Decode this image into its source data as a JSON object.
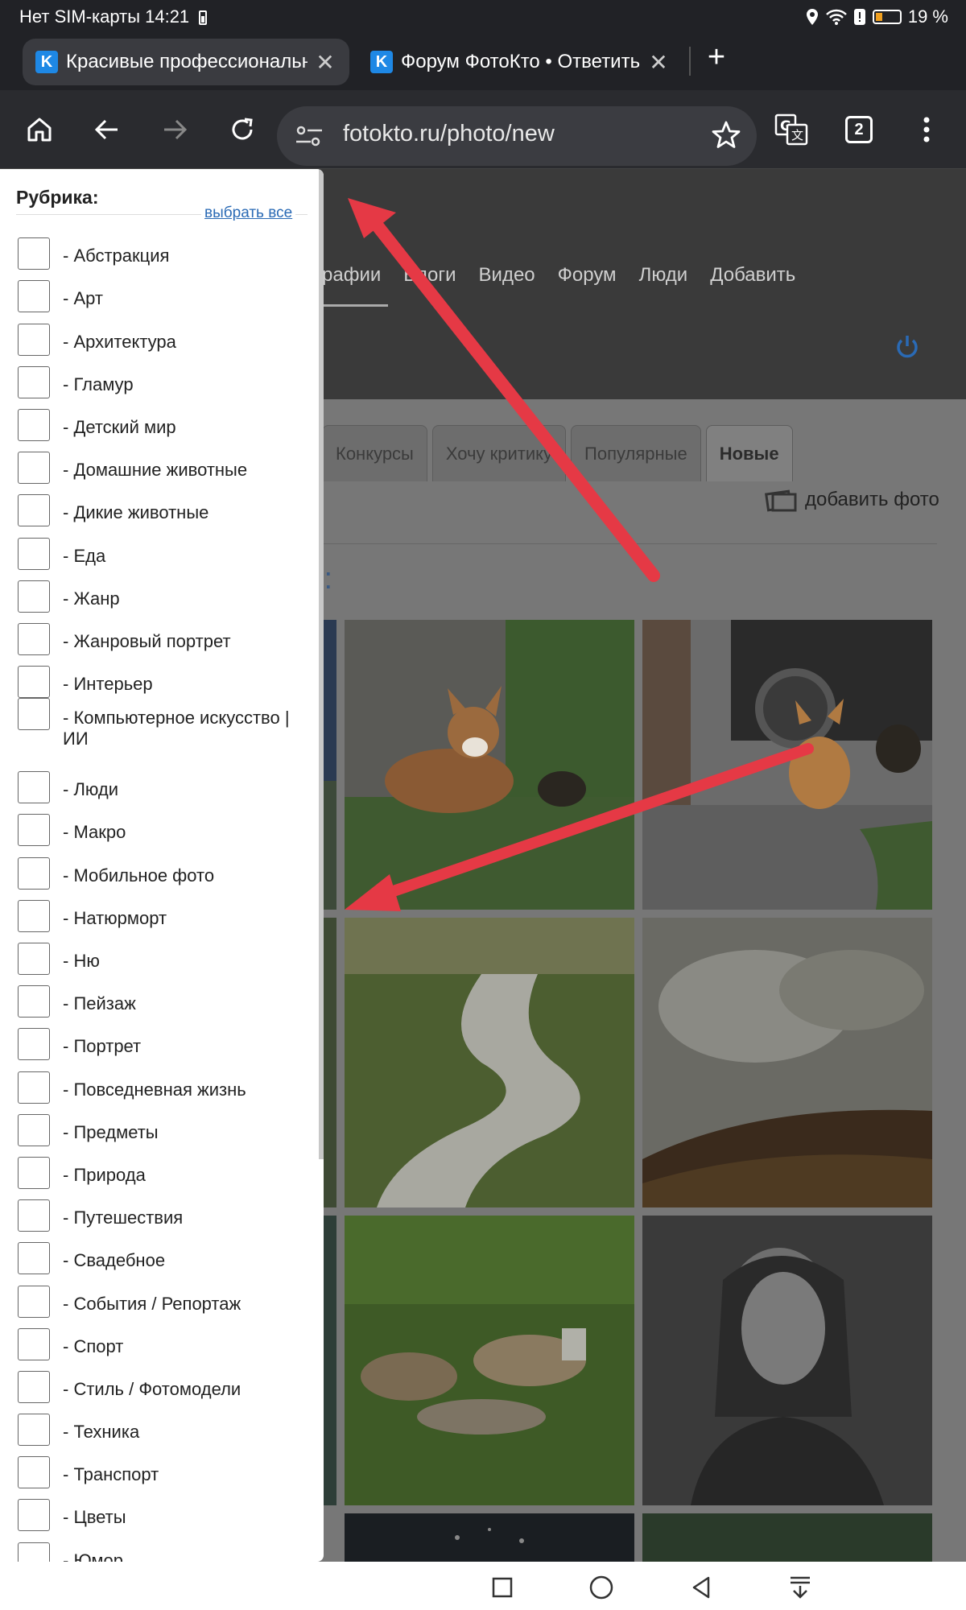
{
  "status": {
    "carrier_time": "Нет SIM-карты 14:21",
    "battery": "19 %"
  },
  "tabs": [
    {
      "label": "Красивые профессиональные",
      "favicon": "K"
    },
    {
      "label": "Форум ФотоКто • Ответить",
      "favicon": "K"
    }
  ],
  "tab_count": "2",
  "omnibox": {
    "url": "fotokto.ru/photo/new"
  },
  "site": {
    "nav": [
      "рафии",
      "Блоги",
      "Видео",
      "Форум",
      "Люди",
      "Добавить"
    ],
    "subtabs": [
      "Конкурсы",
      "Хочу критику",
      "Популярные",
      "Новые"
    ],
    "add_photo": "добавить фото",
    "heading": "ии:"
  },
  "panel": {
    "title": "Рубрика:",
    "select_all": "выбрать все",
    "items": [
      "- Абстракция",
      "- Арт",
      "- Архитектура",
      "- Гламур",
      "- Детский мир",
      "- Домашние животные",
      "- Дикие животные",
      "- Еда",
      "- Жанр",
      "- Жанровый портрет",
      "- Интерьер",
      "- Компьютерное искусство | ИИ",
      "- Люди",
      "- Макро",
      "- Мобильное фото",
      "- Натюрморт",
      "- Ню",
      "- Пейзаж",
      "- Портрет",
      "- Повседневная жизнь",
      "- Предметы",
      "- Природа",
      "- Путешествия",
      "- Свадебное",
      "- События / Репортаж",
      "- Спорт",
      "- Стиль / Фотомодели",
      "- Техника",
      "- Транспорт",
      "- Цветы",
      "- Юмор"
    ]
  },
  "colors": {
    "accent": "#2a6ab5",
    "arrow": "#e53945",
    "chrome_dark": "#212226"
  },
  "icons": {
    "toolbar": [
      "home-icon",
      "back-icon",
      "forward-icon",
      "reload-icon",
      "tune-icon",
      "star-icon",
      "translate-icon",
      "tab-switcher-icon",
      "menu-icon"
    ],
    "navbar": [
      "recent-apps-icon",
      "home-circle-icon",
      "back-triangle-icon",
      "notifications-down-icon"
    ]
  }
}
